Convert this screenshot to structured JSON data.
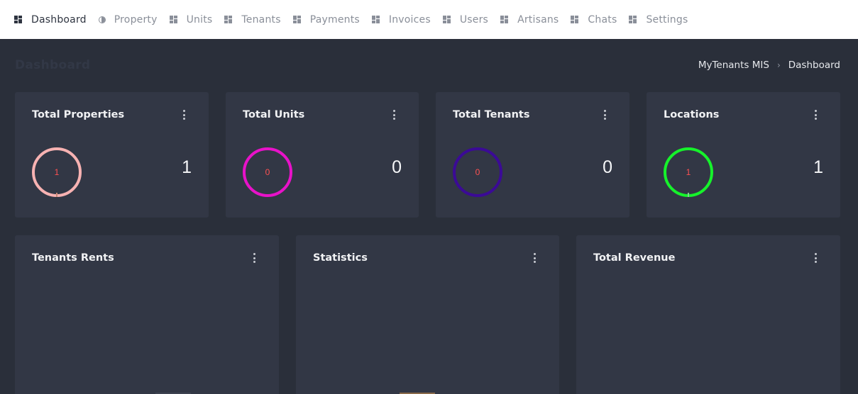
{
  "nav": {
    "items": [
      {
        "label": "Dashboard",
        "icon": "grid-icon"
      },
      {
        "label": "Property",
        "icon": "half-circle-icon"
      },
      {
        "label": "Units",
        "icon": "grid-icon"
      },
      {
        "label": "Tenants",
        "icon": "grid-icon"
      },
      {
        "label": "Payments",
        "icon": "grid-icon"
      },
      {
        "label": "Invoices",
        "icon": "grid-icon"
      },
      {
        "label": "Users",
        "icon": "grid-icon"
      },
      {
        "label": "Artisans",
        "icon": "grid-icon"
      },
      {
        "label": "Chats",
        "icon": "grid-icon"
      },
      {
        "label": "Settings",
        "icon": "grid-icon"
      }
    ],
    "active": "Dashboard"
  },
  "header": {
    "title": "Dashboard",
    "breadcrumb": [
      "MyTenants MIS",
      "Dashboard"
    ]
  },
  "stats": [
    {
      "title": "Total Properties",
      "value": "1",
      "ring_label": "1",
      "ring_color": "#f7b2b2"
    },
    {
      "title": "Total Units",
      "value": "0",
      "ring_label": "0",
      "ring_color": "#e812c9"
    },
    {
      "title": "Total Tenants",
      "value": "0",
      "ring_label": "0",
      "ring_color": "#3b0a96"
    },
    {
      "title": "Locations",
      "value": "1",
      "ring_label": "1",
      "ring_color": "#16f22b"
    }
  ],
  "widgets": [
    {
      "title": "Tenants Rents"
    },
    {
      "title": "Statistics"
    },
    {
      "title": "Total Revenue"
    }
  ],
  "colors": {
    "background": "#2a2f3a",
    "card": "#323745",
    "nav_background": "#ffffff",
    "ring_label": "#ff5151"
  }
}
